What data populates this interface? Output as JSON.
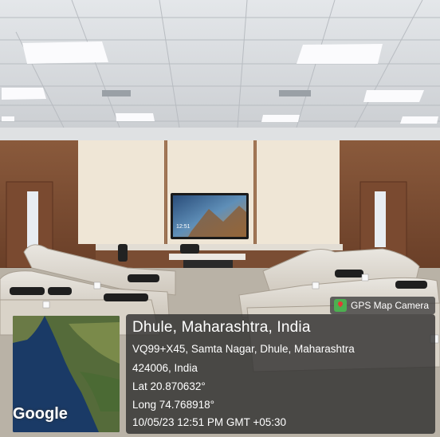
{
  "badge": {
    "label": "GPS Map Camera",
    "icon": "map-pin-icon"
  },
  "location": {
    "title": "Dhule, Maharashtra, India",
    "address_line1": "VQ99+X45, Samta Nagar, Dhule, Maharashtra",
    "address_line2": "424006, India",
    "lat": "Lat 20.870632°",
    "long": "Long 74.768918°",
    "datetime": "10/05/23 12:51 PM GMT +05:30"
  },
  "map": {
    "attribution": "Google"
  },
  "tv": {
    "time": "12:51"
  }
}
